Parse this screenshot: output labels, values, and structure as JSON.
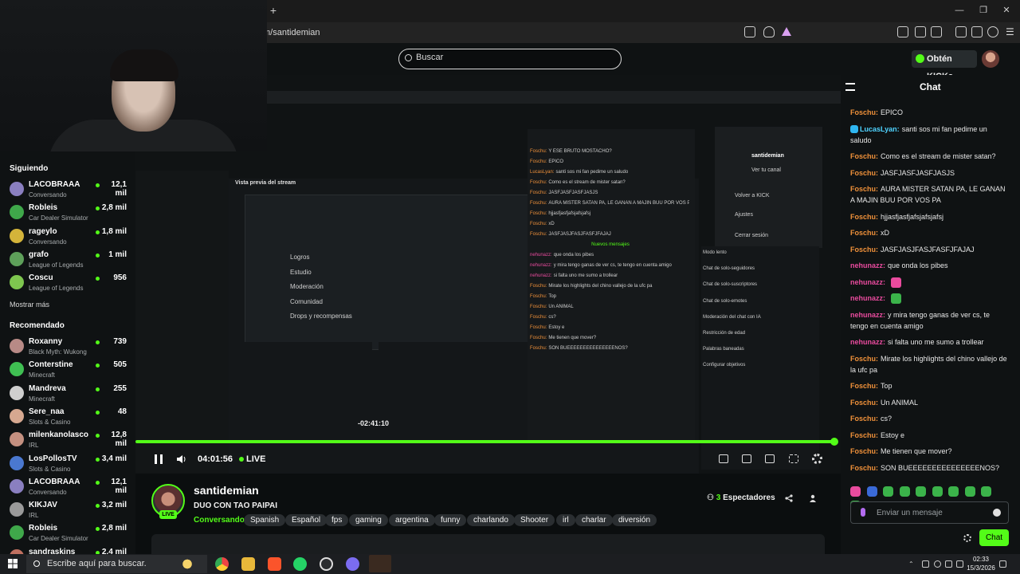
{
  "browser": {
    "url": "m/santidemian",
    "new_tab": "+",
    "win_min": "—",
    "win_max": "❐",
    "win_close": "✕"
  },
  "header": {
    "search_placeholder": "Buscar",
    "kicks_label": "Obtén KICKs"
  },
  "sidebar": {
    "following_title": "Siguiendo",
    "following": [
      {
        "name": "LACOBRAAA",
        "category": "Conversando",
        "viewers": "12,1 mil",
        "color": "#8a7fc0"
      },
      {
        "name": "Robleis",
        "category": "Car Dealer Simulator",
        "viewers": "2,8 mil",
        "color": "#3fa84a"
      },
      {
        "name": "rageylo",
        "category": "Conversando",
        "viewers": "1,8 mil",
        "color": "#d4b43a"
      },
      {
        "name": "grafo",
        "category": "League of Legends",
        "viewers": "1 mil",
        "color": "#5ea05a"
      },
      {
        "name": "Coscu",
        "category": "League of Legends",
        "viewers": "956",
        "color": "#7ec64f"
      }
    ],
    "show_more": "Mostrar más",
    "recommended_title": "Recomendado",
    "recommended": [
      {
        "name": "Roxanny",
        "category": "Black Myth: Wukong",
        "viewers": "739",
        "color": "#b88a86"
      },
      {
        "name": "Conterstine",
        "category": "Minecraft",
        "viewers": "505",
        "color": "#3fbf52"
      },
      {
        "name": "Mandreva",
        "category": "Minecraft",
        "viewers": "255",
        "color": "#cfcfcf"
      },
      {
        "name": "Sere_naa",
        "category": "Slots & Casino",
        "viewers": "48",
        "color": "#d6a890"
      },
      {
        "name": "milenkanolasco",
        "category": "IRL",
        "viewers": "12,8 mil",
        "color": "#c49080"
      },
      {
        "name": "LosPollosTV",
        "category": "Slots & Casino",
        "viewers": "3,4 mil",
        "color": "#4a78d0"
      },
      {
        "name": "LACOBRAAA",
        "category": "Conversando",
        "viewers": "12,1 mil",
        "color": "#8a7fc0"
      },
      {
        "name": "KIKJAV",
        "category": "IRL",
        "viewers": "3,2 mil",
        "color": "#9a9a9a"
      },
      {
        "name": "Robleis",
        "category": "Car Dealer Simulator",
        "viewers": "2,8 mil",
        "color": "#3fa84a"
      },
      {
        "name": "sandraskins",
        "category": "",
        "viewers": "2,4 mil",
        "color": "#c07060"
      }
    ]
  },
  "video": {
    "inner_menu": [
      "Logros",
      "Estudio",
      "Moderación",
      "Comunidad",
      "Drops y recompensas"
    ],
    "inner_preview_title": "Vista previa del stream",
    "inner_chat": [
      {
        "u": "Foschu:",
        "t": "Y ESE BRUTO MOSTACHO?"
      },
      {
        "u": "Foschu:",
        "t": "EPICO"
      },
      {
        "u": "LucasLyan:",
        "t": "santi sos mi fan pedime un saludo"
      },
      {
        "u": "Foschu:",
        "t": "Como es el stream de mister satan?"
      },
      {
        "u": "Foschu:",
        "t": "JASFJASFJASFJASJS"
      },
      {
        "u": "Foschu:",
        "t": "AURA MISTER SATAN PA, LE GANAN A MAJIN BUU POR VOS PA"
      },
      {
        "u": "Foschu:",
        "t": "hjjasfjasfjafsjafsjafsj"
      },
      {
        "u": "Foschu:",
        "t": "xD"
      },
      {
        "u": "Foschu:",
        "t": "JASFJASJFASJFASFJFAJAJ"
      },
      {
        "u": "",
        "t": "Nuevos mensajes"
      },
      {
        "u": "nehunazz:",
        "t": "que onda los pibes"
      },
      {
        "u": "nehunazz:",
        "t": "y mira tengo ganas de ver cs, te tengo en cuenta amigo"
      },
      {
        "u": "nehunazz:",
        "t": "si falta uno me sumo a trollear"
      },
      {
        "u": "Foschu:",
        "t": "Mirate los highlights del chino vallejo de la ufc pa"
      },
      {
        "u": "Foschu:",
        "t": "Top"
      },
      {
        "u": "Foschu:",
        "t": "Un ANIMAL"
      },
      {
        "u": "Foschu:",
        "t": "cs?"
      },
      {
        "u": "Foschu:",
        "t": "Estoy e"
      },
      {
        "u": "Foschu:",
        "t": "Me tienen que mover?"
      },
      {
        "u": "Foschu:",
        "t": "SON BUEEEEEEEEEEEEEEENOS?"
      }
    ],
    "inner_settings": [
      "Modo lento",
      "Chat de solo-seguidores",
      "Chat de solo-suscriptores",
      "Chat de solo-emotes",
      "Moderación del chat con IA",
      "Restricción de edad",
      "Palabras baneadas",
      "Configurar objetivos"
    ],
    "inner_dropdown": [
      "santidemian",
      "Ver tu canal",
      "Volver a KICK",
      "Ajustes",
      "Cerrar sesión"
    ],
    "timestamp": "-02:41:10"
  },
  "player": {
    "progress": 0.99,
    "time": "04:01:56",
    "live_label": "LIVE"
  },
  "stream": {
    "channel": "santidemian",
    "title": "DUO CON TAO PAIPAI",
    "category": "Conversando",
    "live_badge": "LIVE",
    "viewers_count": "3",
    "viewers_label": "Espectadores",
    "tags": [
      "Spanish",
      "Español",
      "fps",
      "gaming",
      "argentina",
      "funny",
      "charlando",
      "Shooter",
      "irl",
      "charlar",
      "diversión"
    ]
  },
  "chat": {
    "title": "Chat",
    "messages": [
      {
        "user": "Foschu:",
        "text": "EPICO",
        "cls": "u-foschu"
      },
      {
        "user": "LucasLyan:",
        "text": "santi sos mi fan pedime un saludo",
        "cls": "u-luc"
      },
      {
        "user": "Foschu:",
        "text": "Como es el stream de mister satan?",
        "cls": "u-foschu"
      },
      {
        "user": "Foschu:",
        "text": "JASFJASFJASFJASJS",
        "cls": "u-foschu"
      },
      {
        "user": "Foschu:",
        "text": "AURA MISTER SATAN PA, LE GANAN A MAJIN BUU POR VOS PA",
        "cls": "u-foschu"
      },
      {
        "user": "Foschu:",
        "text": "hjjasfjasfjafsjafsjafsj",
        "cls": "u-foschu"
      },
      {
        "user": "Foschu:",
        "text": "xD",
        "cls": "u-foschu"
      },
      {
        "user": "Foschu:",
        "text": "JASFJASJFASJFASFJFAJAJ",
        "cls": "u-foschu"
      },
      {
        "user": "nehunazz:",
        "text": "que onda los pibes",
        "cls": "u-nehu"
      },
      {
        "user": "nehunazz:",
        "text": "",
        "cls": "u-nehu",
        "emote": "#e94b9e"
      },
      {
        "user": "nehunazz:",
        "text": "",
        "cls": "u-nehu",
        "emote": "#3bb34a"
      },
      {
        "user": "nehunazz:",
        "text": "y mira tengo ganas de ver cs, te tengo en cuenta amigo",
        "cls": "u-nehu"
      },
      {
        "user": "nehunazz:",
        "text": "si falta uno me sumo a trollear",
        "cls": "u-nehu"
      },
      {
        "user": "Foschu:",
        "text": "Mirate los highlights del chino vallejo de la ufc pa",
        "cls": "u-foschu"
      },
      {
        "user": "Foschu:",
        "text": "Top",
        "cls": "u-foschu"
      },
      {
        "user": "Foschu:",
        "text": "Un ANIMAL",
        "cls": "u-foschu"
      },
      {
        "user": "Foschu:",
        "text": "cs?",
        "cls": "u-foschu"
      },
      {
        "user": "Foschu:",
        "text": "Estoy e",
        "cls": "u-foschu"
      },
      {
        "user": "Foschu:",
        "text": "Me tienen que mover?",
        "cls": "u-foschu"
      },
      {
        "user": "Foschu:",
        "text": "SON BUEEEEEEEEEEEEEEENOS?",
        "cls": "u-foschu"
      }
    ],
    "input_placeholder": "Enviar un mensaje",
    "send_label": "Chat"
  },
  "taskbar": {
    "search_text": "Escribe aquí para buscar.",
    "time": "02:33",
    "date": "15/3/2026"
  }
}
